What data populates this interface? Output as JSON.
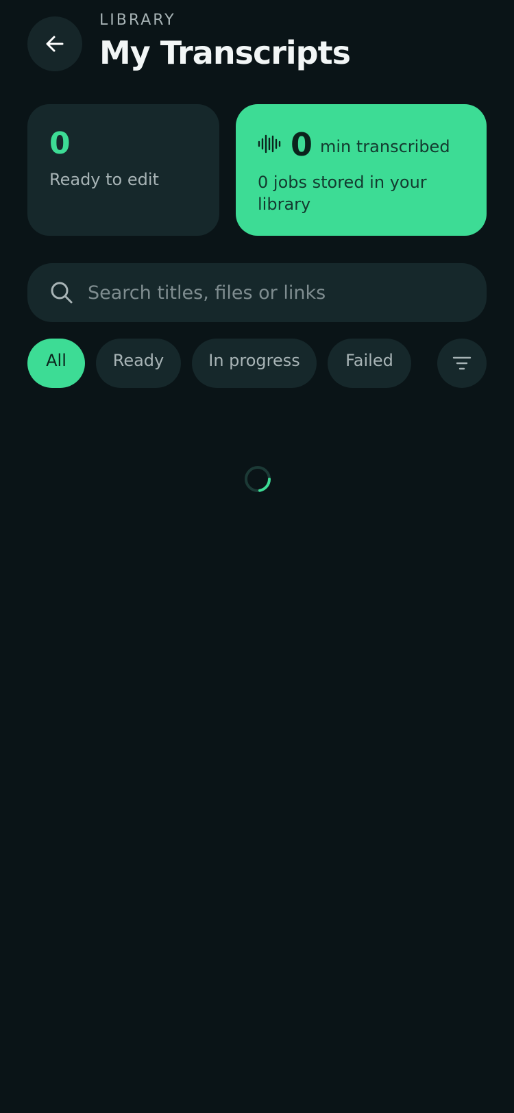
{
  "header": {
    "eyebrow": "LIBRARY",
    "title": "My Transcripts",
    "back_icon": "arrow-left-icon"
  },
  "stats": {
    "ready": {
      "value": "0",
      "label": "Ready to edit"
    },
    "minutes": {
      "icon": "audio-waveform-icon",
      "value": "0",
      "unit": "min transcribed",
      "subtitle": "0 jobs stored in your library"
    }
  },
  "search": {
    "icon": "search-icon",
    "placeholder": "Search titles, files or links",
    "value": ""
  },
  "filters": {
    "chips": [
      {
        "label": "All",
        "active": true
      },
      {
        "label": "Ready",
        "active": false
      },
      {
        "label": "In progress",
        "active": false
      },
      {
        "label": "Failed",
        "active": false
      }
    ],
    "sort_icon": "filter-lines-icon"
  },
  "status": {
    "loading": true
  },
  "colors": {
    "background": "#0a1417",
    "surface": "#16282b",
    "accent": "#3ddc95",
    "muted_text": "#a8b4b6"
  }
}
